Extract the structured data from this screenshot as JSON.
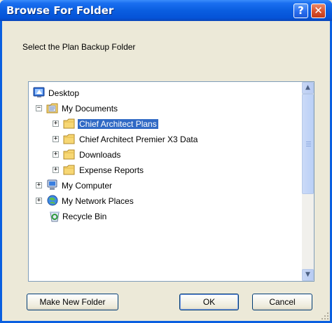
{
  "window": {
    "title": "Browse For Folder",
    "help_label": "?",
    "close_label": "✕"
  },
  "prompt": "Select the Plan Backup Folder",
  "tree": {
    "desktop": "Desktop",
    "my_documents": "My Documents",
    "chief_architect_plans": "Chief Architect Plans",
    "chief_architect_premier": "Chief Architect Premier X3 Data",
    "downloads": "Downloads",
    "expense_reports": "Expense Reports",
    "my_computer": "My Computer",
    "my_network_places": "My Network Places",
    "recycle_bin": "Recycle Bin",
    "selected": "Chief Architect Plans"
  },
  "buttons": {
    "make_new_folder": "Make New Folder",
    "ok": "OK",
    "cancel": "Cancel"
  },
  "icons": {
    "folder": "folder-icon",
    "desktop": "desktop-icon",
    "computer": "my-computer-icon",
    "network": "network-places-icon",
    "recycle": "recycle-bin-icon"
  }
}
